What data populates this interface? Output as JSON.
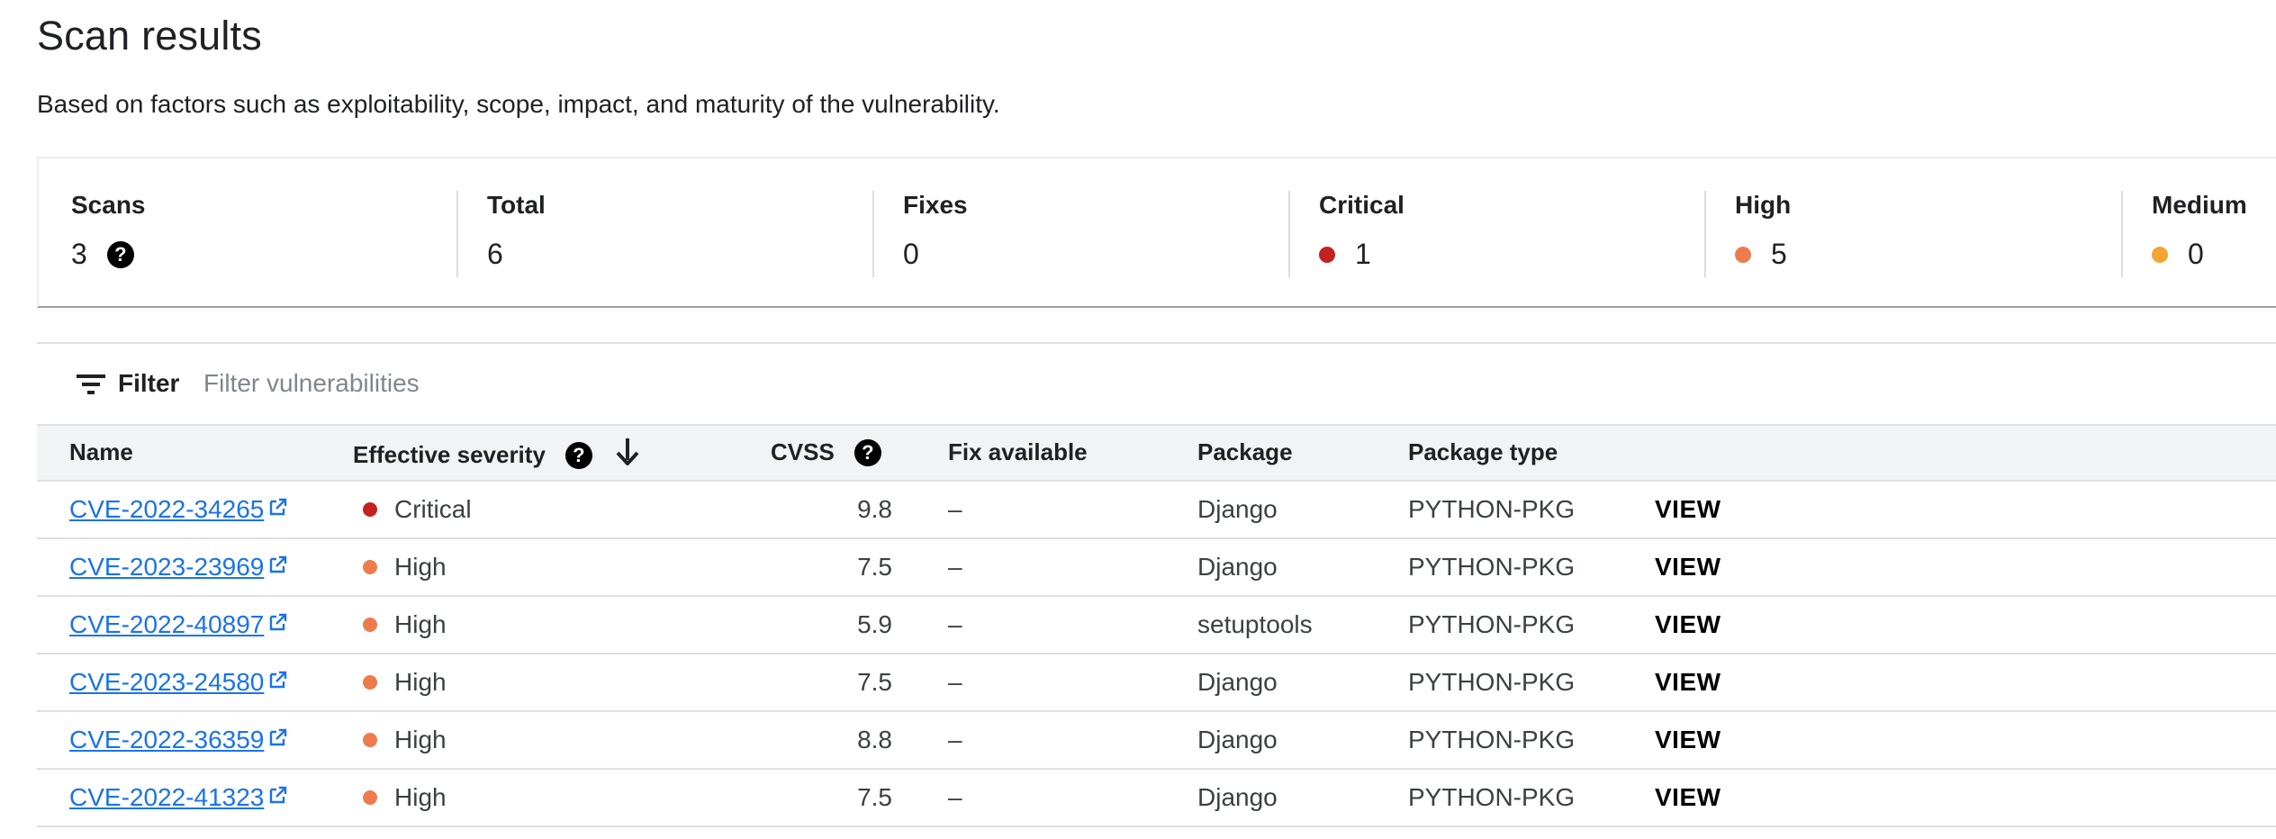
{
  "header": {
    "title": "Scan results",
    "subtitle": "Based on factors such as exploitability, scope, impact, and maturity of the vulnerability."
  },
  "summary": {
    "scans": {
      "label": "Scans",
      "value": "3",
      "icon": "help-icon"
    },
    "total": {
      "label": "Total",
      "value": "6"
    },
    "fixes": {
      "label": "Fixes",
      "value": "0"
    },
    "critical": {
      "label": "Critical",
      "value": "1",
      "color": "#c5221f"
    },
    "high": {
      "label": "High",
      "value": "5",
      "color": "#ee7b4b"
    },
    "medium": {
      "label": "Medium",
      "value": "0",
      "color": "#f2a531"
    }
  },
  "filter": {
    "label": "Filter",
    "placeholder": "Filter vulnerabilities",
    "icon": "filter-icon"
  },
  "table": {
    "columns": {
      "name": "Name",
      "severity": "Effective severity",
      "cvss": "CVSS",
      "fix": "Fix available",
      "package": "Package",
      "type": "Package type"
    },
    "rows": [
      {
        "name": "CVE-2022-34265",
        "severity": "Critical",
        "severity_color": "#c5221f",
        "cvss": "9.8",
        "fix": "–",
        "package": "Django",
        "type": "PYTHON-PKG",
        "action": "VIEW"
      },
      {
        "name": "CVE-2023-23969",
        "severity": "High",
        "severity_color": "#ee7b4b",
        "cvss": "7.5",
        "fix": "–",
        "package": "Django",
        "type": "PYTHON-PKG",
        "action": "VIEW"
      },
      {
        "name": "CVE-2022-40897",
        "severity": "High",
        "severity_color": "#ee7b4b",
        "cvss": "5.9",
        "fix": "–",
        "package": "setuptools",
        "type": "PYTHON-PKG",
        "action": "VIEW"
      },
      {
        "name": "CVE-2023-24580",
        "severity": "High",
        "severity_color": "#ee7b4b",
        "cvss": "7.5",
        "fix": "–",
        "package": "Django",
        "type": "PYTHON-PKG",
        "action": "VIEW"
      },
      {
        "name": "CVE-2022-36359",
        "severity": "High",
        "severity_color": "#ee7b4b",
        "cvss": "8.8",
        "fix": "–",
        "package": "Django",
        "type": "PYTHON-PKG",
        "action": "VIEW"
      },
      {
        "name": "CVE-2022-41323",
        "severity": "High",
        "severity_color": "#ee7b4b",
        "cvss": "7.5",
        "fix": "–",
        "package": "Django",
        "type": "PYTHON-PKG",
        "action": "VIEW"
      }
    ]
  }
}
